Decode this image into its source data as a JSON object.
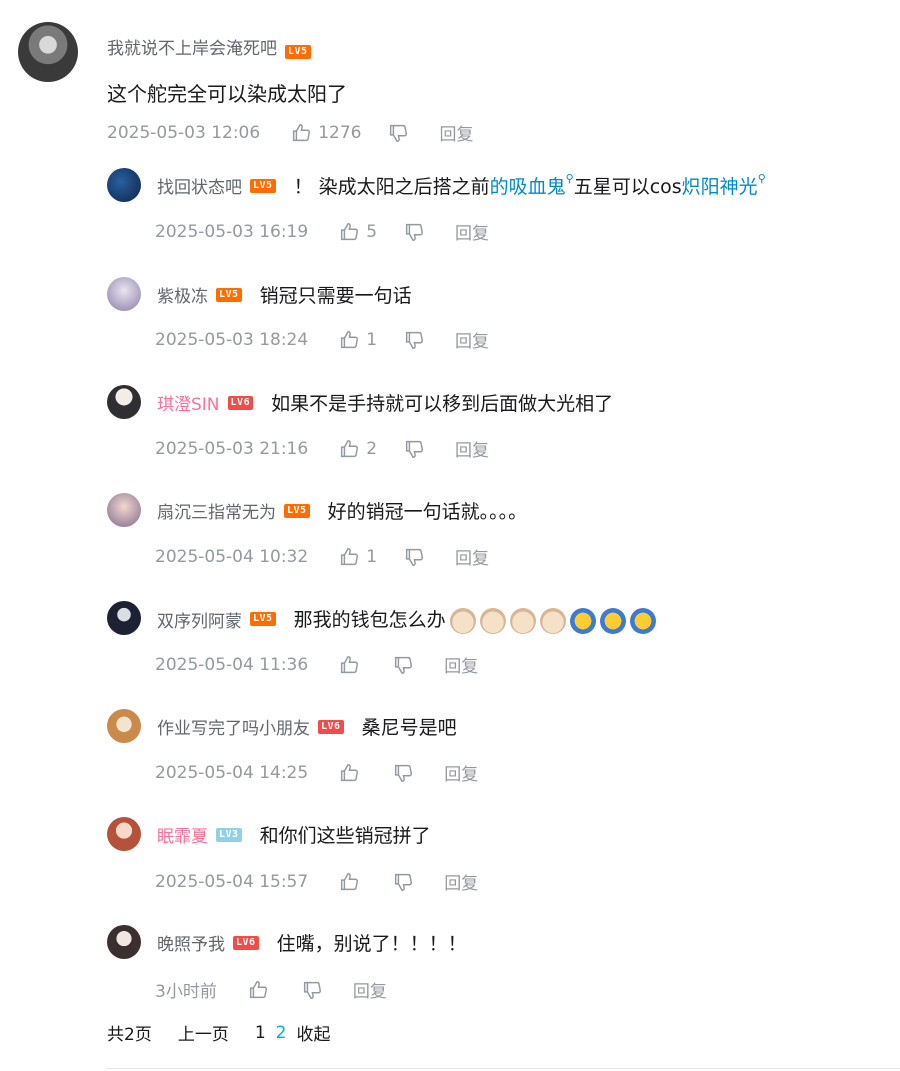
{
  "root": {
    "username": "我就说不上岸会淹死吧",
    "level": "LV5",
    "text": "这个舵完全可以染成太阳了",
    "date": "2025-05-03 12:06",
    "likes": "1276",
    "reply_label": "回复"
  },
  "replies": [
    {
      "username": "找回状态吧",
      "level": "LV5",
      "text_prefix": "！ 染成太阳之后搭之前",
      "link1": "的吸血鬼",
      "text_mid": "五星可以cos",
      "link2": "炽阳神光",
      "date": "2025-05-03 16:19",
      "likes": "5",
      "reply_label": "回复"
    },
    {
      "username": "紫极冻",
      "level": "LV5",
      "text": "销冠只需要一句话",
      "date": "2025-05-03 18:24",
      "likes": "1",
      "reply_label": "回复"
    },
    {
      "username": "琪澄SIN",
      "level": "LV6",
      "text": "如果不是手持就可以移到后面做大光相了",
      "date": "2025-05-03 21:16",
      "likes": "2",
      "reply_label": "回复"
    },
    {
      "username": "扇沉三指常无为",
      "level": "LV5",
      "text": "好的销冠一句话就。。。。",
      "date": "2025-05-04 10:32",
      "likes": "1",
      "reply_label": "回复"
    },
    {
      "username": "双序列阿蒙",
      "level": "LV5",
      "text": "那我的钱包怎么办",
      "date": "2025-05-04 11:36",
      "likes": "",
      "reply_label": "回复"
    },
    {
      "username": "作业写完了吗小朋友",
      "level": "LV6",
      "text": "桑尼号是吧",
      "date": "2025-05-04 14:25",
      "likes": "",
      "reply_label": "回复"
    },
    {
      "username": "眠霏夏",
      "level": "LV3",
      "text": "和你们这些销冠拼了",
      "date": "2025-05-04 15:57",
      "likes": "",
      "reply_label": "回复"
    },
    {
      "username": "晚照予我",
      "level": "LV6",
      "text": "住嘴，别说了！！！！",
      "date": "3小时前",
      "likes": "",
      "reply_label": "回复"
    }
  ],
  "pager": {
    "total": "共2页",
    "prev": "上一页",
    "page1": "1",
    "page2": "2",
    "collapse": "收起"
  },
  "colors": {
    "accent": "#00aeec",
    "pink_name": "#fb7299",
    "link": "#008ac5"
  }
}
